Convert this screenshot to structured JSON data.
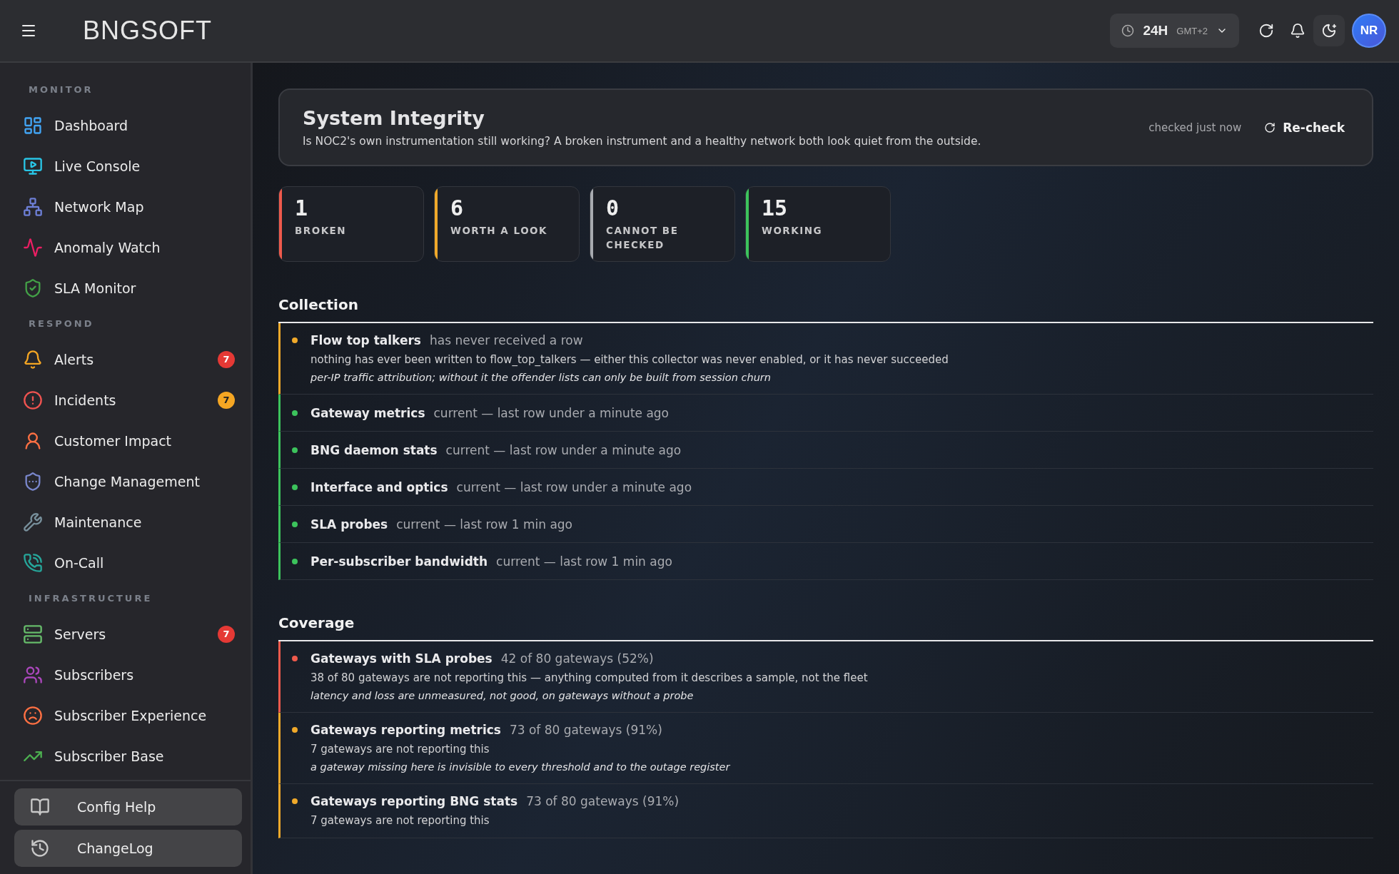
{
  "topbar": {
    "logo": "BNGSOFT",
    "time_range": {
      "value": "24H",
      "zone": "GMT+2"
    },
    "avatar": "NR"
  },
  "sidebar": {
    "sections": [
      {
        "label": "MONITOR",
        "items": [
          {
            "label": "Dashboard"
          },
          {
            "label": "Live Console"
          },
          {
            "label": "Network Map"
          },
          {
            "label": "Anomaly Watch"
          },
          {
            "label": "SLA Monitor"
          }
        ]
      },
      {
        "label": "RESPOND",
        "items": [
          {
            "label": "Alerts",
            "badge": "7",
            "color": "#e53935"
          },
          {
            "label": "Incidents",
            "badge": "7",
            "color": "#f5a623"
          },
          {
            "label": "Customer Impact"
          },
          {
            "label": "Change Management"
          },
          {
            "label": "Maintenance"
          },
          {
            "label": "On-Call"
          }
        ]
      },
      {
        "label": "INFRASTRUCTURE",
        "items": [
          {
            "label": "Servers",
            "badge": "7",
            "color": "#e53935"
          },
          {
            "label": "Subscribers"
          },
          {
            "label": "Subscriber Experience"
          },
          {
            "label": "Subscriber Base"
          }
        ]
      }
    ],
    "footer": [
      "Config Help",
      "ChangeLog"
    ]
  },
  "header": {
    "title": "System Integrity",
    "subtitle": "Is NOC2's own instrumentation still working? A broken instrument and a healthy network both look quiet from the outside.",
    "checked": "checked just now",
    "action": "Re-check"
  },
  "stats": [
    {
      "value": "1",
      "label": "BROKEN",
      "color": "#ef5a4c"
    },
    {
      "value": "6",
      "label": "WORTH A LOOK",
      "color": "#f0a92a"
    },
    {
      "value": "0",
      "label": "CANNOT BE CHECKED",
      "color": "#a8abb0"
    },
    {
      "value": "15",
      "label": "WORKING",
      "color": "#3cc35c"
    }
  ],
  "sections": [
    {
      "title": "Collection",
      "rows": [
        {
          "name": "Flow top talkers",
          "status": "has never received a row",
          "color": "#f0a92a",
          "detail": "nothing has ever been written to flow_top_talkers — either this collector was never enabled, or it has never succeeded",
          "note": "per-IP traffic attribution; without it the offender lists can only be built from session churn"
        },
        {
          "name": "Gateway metrics",
          "status": "current — last row under a minute ago",
          "color": "#3cc35c"
        },
        {
          "name": "BNG daemon stats",
          "status": "current — last row under a minute ago",
          "color": "#3cc35c"
        },
        {
          "name": "Interface and optics",
          "status": "current — last row under a minute ago",
          "color": "#3cc35c"
        },
        {
          "name": "SLA probes",
          "status": "current — last row 1 min ago",
          "color": "#3cc35c"
        },
        {
          "name": "Per-subscriber bandwidth",
          "status": "current — last row 1 min ago",
          "color": "#3cc35c"
        }
      ]
    },
    {
      "title": "Coverage",
      "rows": [
        {
          "name": "Gateways with SLA probes",
          "status": "42 of 80 gateways (52%)",
          "color": "#ef5a4c",
          "detail": "38 of 80 gateways are not reporting this — anything computed from it describes a sample, not the fleet",
          "note": "latency and loss are unmeasured, not good, on gateways without a probe"
        },
        {
          "name": "Gateways reporting metrics",
          "status": "73 of 80 gateways (91%)",
          "color": "#f0a92a",
          "detail": "7 gateways are not reporting this",
          "note": "a gateway missing here is invisible to every threshold and to the outage register"
        },
        {
          "name": "Gateways reporting BNG stats",
          "status": "73 of 80 gateways (91%)",
          "color": "#f0a92a",
          "detail": "7 gateways are not reporting this"
        }
      ]
    }
  ]
}
